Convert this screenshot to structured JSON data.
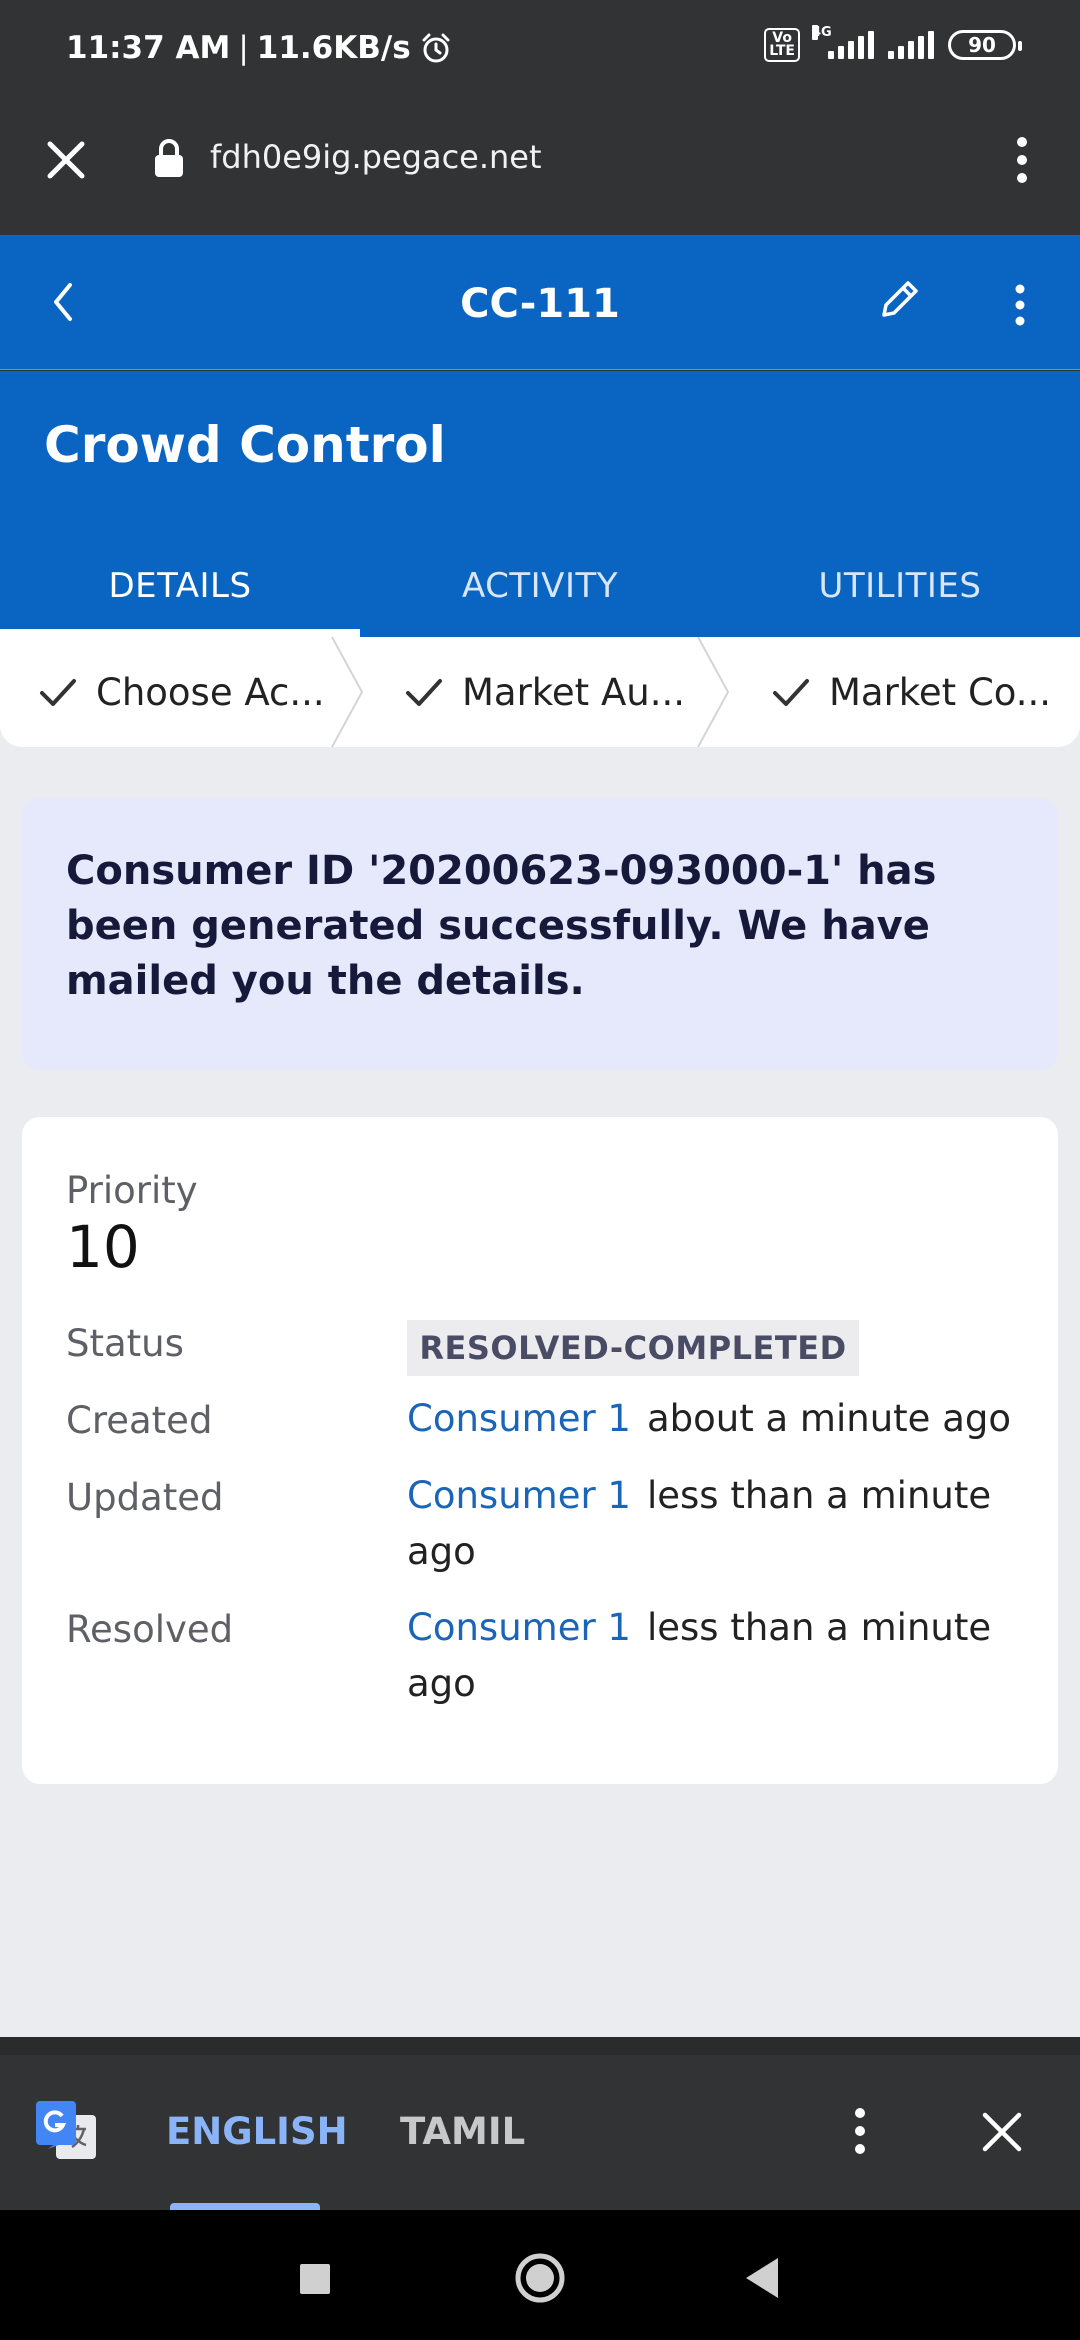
{
  "status_bar": {
    "time": "11:37 AM",
    "separator": "|",
    "speed": "11.6KB/s",
    "volte_top": "Vo",
    "volte_bottom": "LTE",
    "network": "4G",
    "battery": "90"
  },
  "browser": {
    "url": "fdh0e9ig.pegace.net",
    "close_icon": "close-icon",
    "lock_icon": "lock-icon",
    "more_icon": "more-vert-icon"
  },
  "header": {
    "case_id": "CC-111",
    "back_icon": "chevron-left-icon",
    "edit_icon": "pencil-icon",
    "more_icon": "more-vert-icon"
  },
  "case": {
    "title": "Crowd Control"
  },
  "tabs": [
    {
      "label": "DETAILS",
      "active": true
    },
    {
      "label": "ACTIVITY",
      "active": false
    },
    {
      "label": "UTILITIES",
      "active": false
    }
  ],
  "stages": [
    {
      "label": "Choose Ac...",
      "completed": true
    },
    {
      "label": "Market Au...",
      "completed": true
    },
    {
      "label": "Market Co...",
      "completed": true
    }
  ],
  "alert": {
    "message": "Consumer ID '20200623-093000-1' has been generated successfully. We have mailed you the details."
  },
  "details": {
    "priority_label": "Priority",
    "priority_value": "10",
    "status_label": "Status",
    "status_value": "RESOLVED-COMPLETED",
    "created_label": "Created",
    "created_by": "Consumer 1",
    "created_when": "about a minute ago",
    "updated_label": "Updated",
    "updated_by": "Consumer 1",
    "updated_when": "less than a minute ago",
    "resolved_label": "Resolved",
    "resolved_by": "Consumer 1",
    "resolved_when": "less than a minute ago"
  },
  "translate": {
    "lang_1": "ENGLISH",
    "lang_2": "TAMIL",
    "selected": "ENGLISH"
  },
  "colors": {
    "brand_blue": "#0a65c2",
    "link_blue": "#1a65b7",
    "alert_bg": "#e6e9fb",
    "translate_accent": "#8ab4f8"
  }
}
